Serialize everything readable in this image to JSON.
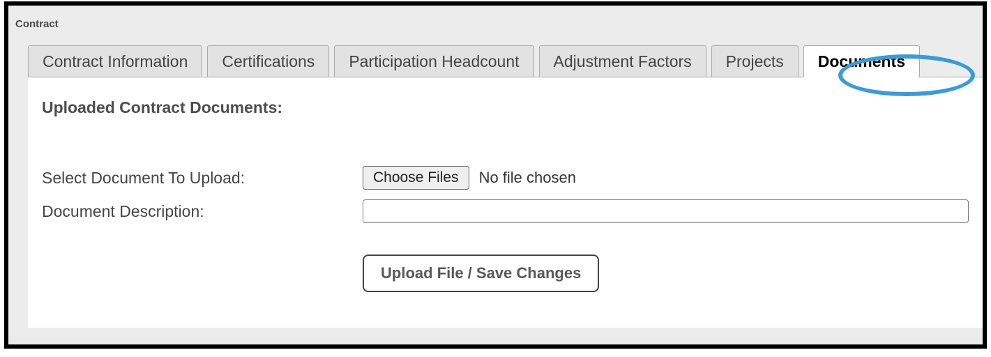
{
  "panel": {
    "label": "Contract"
  },
  "tabs": {
    "items": [
      {
        "label": "Contract Information"
      },
      {
        "label": "Certifications"
      },
      {
        "label": "Participation Headcount"
      },
      {
        "label": "Adjustment Factors"
      },
      {
        "label": "Projects"
      },
      {
        "label": "Documents"
      }
    ],
    "activeIndex": 5
  },
  "content": {
    "heading": "Uploaded Contract Documents:",
    "selectDocLabel": "Select Document To Upload:",
    "chooseFilesBtn": "Choose Files",
    "fileStatus": "No file chosen",
    "docDescLabel": "Document Description:",
    "docDescValue": "",
    "uploadBtn": "Upload File / Save Changes"
  }
}
